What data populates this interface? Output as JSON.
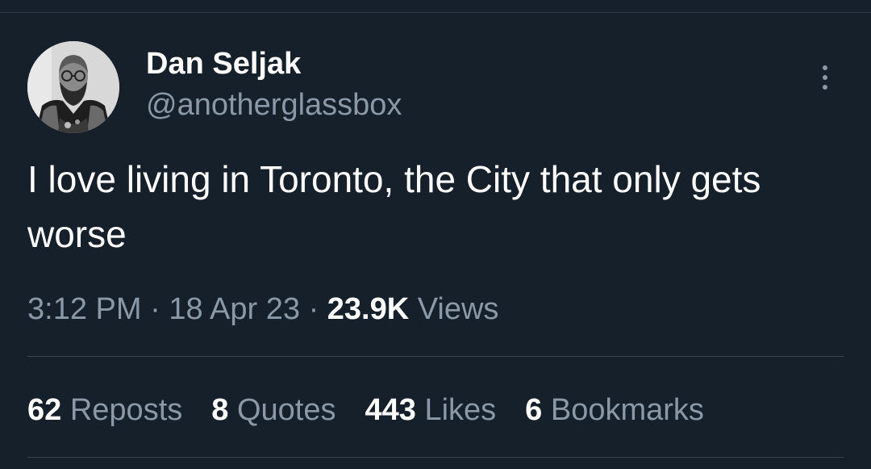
{
  "author": {
    "display_name": "Dan Seljak",
    "handle": "@anotherglassbox"
  },
  "tweet": {
    "text": "I love living in Toronto, the City that only gets worse"
  },
  "meta": {
    "time": "3:12 PM",
    "separator": "·",
    "date": "18 Apr 23",
    "views_count": "23.9K",
    "views_label": "Views"
  },
  "stats": {
    "reposts_count": "62",
    "reposts_label": "Reposts",
    "quotes_count": "8",
    "quotes_label": "Quotes",
    "likes_count": "443",
    "likes_label": "Likes",
    "bookmarks_count": "6",
    "bookmarks_label": "Bookmarks"
  },
  "icons": {
    "more": "more-vertical-icon"
  },
  "colors": {
    "background": "#15202b",
    "primary_text": "#ffffff",
    "secondary_text": "#8b98a5",
    "divider": "#38444d"
  }
}
